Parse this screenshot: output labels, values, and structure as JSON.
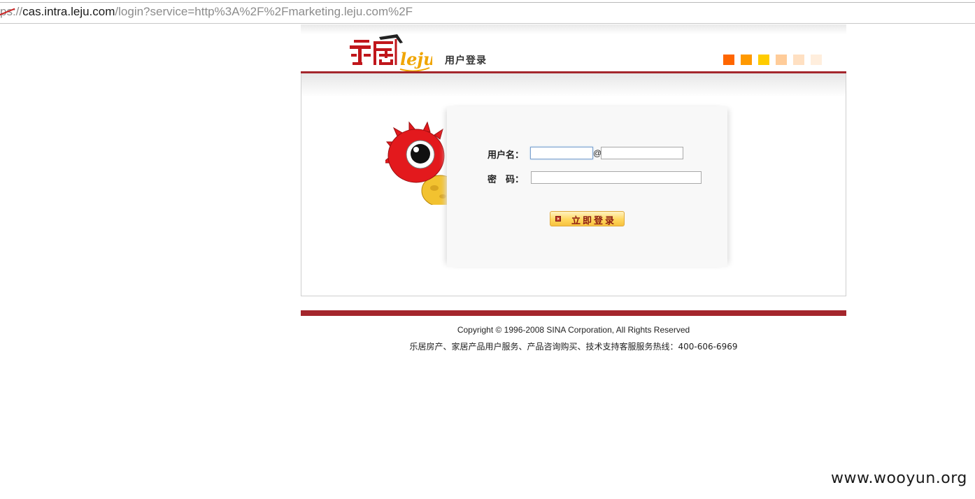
{
  "browser": {
    "url_scheme_partial": "ps://",
    "url_host": "cas.intra.leju.com",
    "url_path": "/login?service=http%3A%2F%2Fmarketing.leju.com%2F"
  },
  "header": {
    "logo_alt": "乐居 leju",
    "page_heading": "用户登录",
    "accent_squares": [
      "#ff6600",
      "#ff9900",
      "#ffcc00",
      "#ffcc99",
      "#ffe0c2",
      "#ffeedd"
    ]
  },
  "form": {
    "username_label": "用户名：",
    "username_value": "",
    "domain_separator": "@",
    "domain_value": "",
    "password_label": "密　码：",
    "password_value": "",
    "login_button_label": "立即登录"
  },
  "footer": {
    "copyright": "Copyright © 1996-2008 SINA Corporation, All Rights Reserved",
    "hotline": "乐居房产、家居产品用户服务、产品咨询购买、技术支持客服服务热线：400-606-6969"
  },
  "watermark": "www.wooyun.org",
  "colors": {
    "brand_red": "#a4262c",
    "logo_red": "#c0161b",
    "logo_gold": "#f0a500",
    "button_gold": "#ffd75e"
  }
}
